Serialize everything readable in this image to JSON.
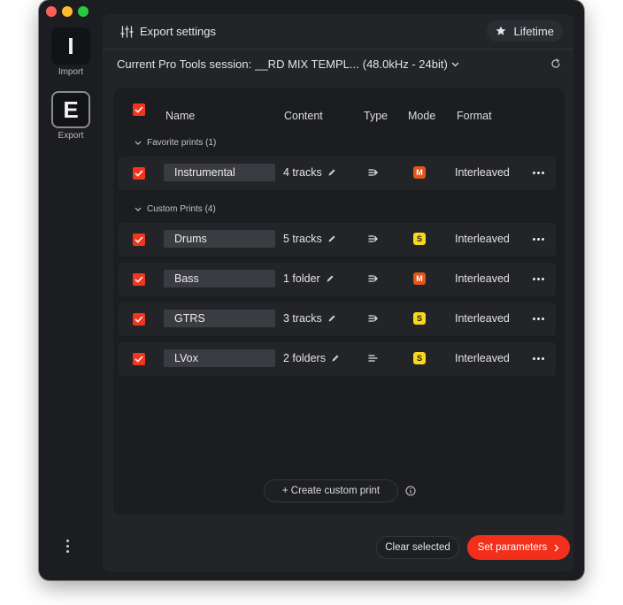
{
  "sidebar": {
    "import_letter": "I",
    "import_label": "Import",
    "export_letter": "E",
    "export_label": "Export"
  },
  "topbar": {
    "title": "Export settings",
    "lifetime_label": "Lifetime"
  },
  "session": {
    "label": "Current Pro Tools session:",
    "name": "__RD MIX TEMPL...",
    "format": "(48.0kHz - 24bit)"
  },
  "table": {
    "headers": {
      "name": "Name",
      "content": "Content",
      "type": "Type",
      "mode": "Mode",
      "format": "Format"
    },
    "groups": [
      {
        "label": "Favorite prints (1)",
        "rows": [
          {
            "name": "Instrumental",
            "content": "4 tracks",
            "type_icon": "align-right-arrow-icon",
            "mode": "M",
            "format": "Interleaved"
          }
        ]
      },
      {
        "label": "Custom Prints (4)",
        "rows": [
          {
            "name": "Drums",
            "content": "5 tracks",
            "type_icon": "align-right-arrow-icon",
            "mode": "S",
            "format": "Interleaved"
          },
          {
            "name": "Bass",
            "content": "1 folder",
            "type_icon": "align-right-arrow-icon",
            "mode": "M",
            "format": "Interleaved"
          },
          {
            "name": "GTRS",
            "content": "3 tracks",
            "type_icon": "align-right-arrow-icon",
            "mode": "S",
            "format": "Interleaved"
          },
          {
            "name": "LVox",
            "content": "2 folders",
            "type_icon": "align-left-lines-icon",
            "mode": "S",
            "format": "Interleaved"
          }
        ]
      }
    ]
  },
  "actions": {
    "create_label": "+ Create custom print",
    "clear_label": "Clear selected",
    "set_label": "Set parameters"
  },
  "colors": {
    "accent": "#f22f1b",
    "mode_m": "#e3561a",
    "mode_s": "#f9d71c",
    "window_bg": "#1c1d21"
  }
}
